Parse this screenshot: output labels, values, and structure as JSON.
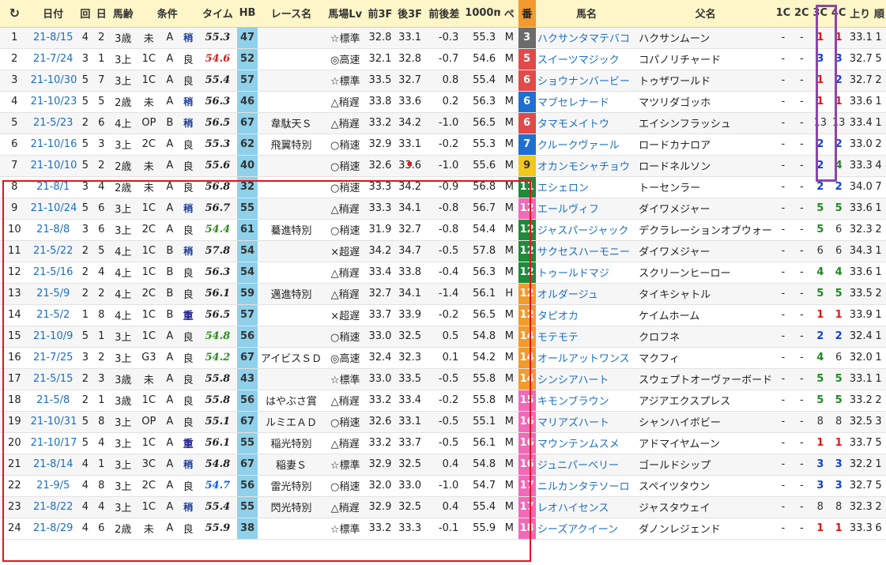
{
  "header": {
    "reload_glyph": "↻",
    "cols": [
      "日付",
      "回",
      "日",
      "馬齢",
      "条件",
      "",
      "",
      "タイム",
      "HB",
      "レース名",
      "馬場Lv",
      "前3F",
      "後3F",
      "前後差",
      "1000m",
      "ペ",
      "番",
      "馬名",
      "父名",
      "1C",
      "2C",
      "3C",
      "4C",
      "上り",
      "順"
    ]
  },
  "colors": {
    "red_box": "#e8121e",
    "purple_box": "#8e44ad",
    "hb_bg": "#8fd1ea",
    "header_bg": "#fdf6c8"
  },
  "rows": [
    {
      "no": "1",
      "date": "21-8/15",
      "kai": "4",
      "nichi": "2",
      "rei": "3歳",
      "jk": "未",
      "cls": "A",
      "baba": "稍",
      "time": "55.3",
      "tc": "black",
      "hb": "47",
      "race": "",
      "lv": "☆標準",
      "f3": "32.8",
      "l3": "33.1",
      "diff": "-0.3",
      "m1000": "55.3",
      "pe": "M",
      "ban": "3",
      "banc": "#6b6b6b",
      "horse": "ハクサンタマテバコ",
      "father": "ハクサンムーン",
      "c1": "-",
      "c2": "-",
      "c3": "1",
      "c3c": "red",
      "c4": "1",
      "c4c": "red",
      "agari": "33.1",
      "juni": "1",
      "bar": "#f7d2c4"
    },
    {
      "no": "2",
      "date": "21-7/24",
      "kai": "3",
      "nichi": "1",
      "rei": "3上",
      "jk": "1C",
      "cls": "A",
      "baba": "良",
      "time": "54.6",
      "tc": "red",
      "hb": "52",
      "race": "",
      "lv": "◎高速",
      "f3": "32.1",
      "l3": "32.8",
      "diff": "-0.7",
      "m1000": "54.6",
      "pe": "M",
      "ban": "5",
      "banc": "#e24a4a",
      "horse": "スイーツマジック",
      "father": "コパノリチャード",
      "c1": "-",
      "c2": "-",
      "c3": "3",
      "c3c": "blue",
      "c4": "3",
      "c4c": "blue",
      "agari": "32.7",
      "juni": "5",
      "bar": ""
    },
    {
      "no": "3",
      "date": "21-10/30",
      "kai": "5",
      "nichi": "7",
      "rei": "3上",
      "jk": "1C",
      "cls": "A",
      "baba": "良",
      "time": "55.4",
      "tc": "black",
      "hb": "57",
      "race": "",
      "lv": "☆標準",
      "f3": "33.5",
      "l3": "32.7",
      "diff": "0.8",
      "m1000": "55.4",
      "pe": "M",
      "ban": "6",
      "banc": "#e24a4a",
      "horse": "ショウナンバービー",
      "father": "トゥザワールド",
      "c1": "-",
      "c2": "-",
      "c3": "1",
      "c3c": "red",
      "c4": "2",
      "c4c": "blue",
      "agari": "32.7",
      "juni": "2",
      "bar": "#fde2a8"
    },
    {
      "no": "4",
      "date": "21-10/23",
      "kai": "5",
      "nichi": "5",
      "rei": "2歳",
      "jk": "未",
      "cls": "A",
      "baba": "稍",
      "time": "56.3",
      "tc": "black",
      "hb": "46",
      "race": "",
      "lv": "△稍遅",
      "f3": "33.8",
      "l3": "33.6",
      "diff": "0.2",
      "m1000": "56.3",
      "pe": "M",
      "ban": "6",
      "banc": "#1f6fd1",
      "horse": "マブセレナード",
      "father": "マツリダゴッホ",
      "c1": "-",
      "c2": "-",
      "c3": "1",
      "c3c": "red",
      "c4": "1",
      "c4c": "red",
      "agari": "33.6",
      "juni": "1",
      "bar": "#f7d2c4"
    },
    {
      "no": "5",
      "date": "21-5/23",
      "kai": "2",
      "nichi": "6",
      "rei": "4上",
      "jk": "OP",
      "cls": "B",
      "baba": "稍",
      "time": "56.5",
      "tc": "black",
      "hb": "67",
      "race": "韋駄天Ｓ",
      "lv": "△稍遅",
      "f3": "33.2",
      "l3": "34.2",
      "diff": "-1.0",
      "m1000": "56.5",
      "pe": "M",
      "ban": "6",
      "banc": "#e24a4a",
      "horse": "タマモメイトウ",
      "father": "エイシンフラッシュ",
      "c1": "-",
      "c2": "-",
      "c3": "13",
      "c3c": "black",
      "c4": "13",
      "c4c": "black",
      "agari": "33.4",
      "juni": "1",
      "bar": "#c9d6f5"
    },
    {
      "no": "6",
      "date": "21-10/16",
      "kai": "5",
      "nichi": "3",
      "rei": "3上",
      "jk": "2C",
      "cls": "A",
      "baba": "良",
      "time": "55.3",
      "tc": "black",
      "hb": "62",
      "race": "飛翼特別",
      "lv": "○稍速",
      "f3": "32.9",
      "l3": "33.1",
      "diff": "-0.2",
      "m1000": "55.3",
      "pe": "M",
      "ban": "7",
      "banc": "#1f6fd1",
      "horse": "クルークヴァール",
      "father": "ロードカナロア",
      "c1": "-",
      "c2": "-",
      "c3": "2",
      "c3c": "blue",
      "c4": "2",
      "c4c": "blue",
      "agari": "33.0",
      "juni": "2",
      "bar": "#fde2a8"
    },
    {
      "no": "7",
      "date": "21-10/10",
      "kai": "5",
      "nichi": "2",
      "rei": "2歳",
      "jk": "未",
      "cls": "A",
      "baba": "良",
      "time": "55.6",
      "tc": "black",
      "hb": "40",
      "race": "",
      "lv": "○稍速",
      "f3": "32.6",
      "l3": "33.6",
      "diff": "-1.0",
      "m1000": "55.6",
      "pe": "M",
      "ban": "9",
      "banc": "#f2c91a",
      "horse": "オカンモシャチョウ",
      "father": "ロードネルソン",
      "c1": "-",
      "c2": "-",
      "c3": "2",
      "c3c": "blue",
      "c4": "4",
      "c4c": "green",
      "agari": "33.3",
      "juni": "4",
      "bar": ""
    },
    {
      "no": "8",
      "date": "21-8/1",
      "kai": "3",
      "nichi": "4",
      "rei": "2歳",
      "jk": "未",
      "cls": "A",
      "baba": "良",
      "time": "56.8",
      "tc": "black",
      "hb": "32",
      "race": "",
      "lv": "○稍速",
      "f3": "33.3",
      "l3": "34.2",
      "diff": "-0.9",
      "m1000": "56.8",
      "pe": "M",
      "ban": "11",
      "banc": "#1f8a3a",
      "horse": "エシェロン",
      "father": "トーセンラー",
      "c1": "-",
      "c2": "-",
      "c3": "2",
      "c3c": "blue",
      "c4": "2",
      "c4c": "blue",
      "agari": "34.0",
      "juni": "7",
      "bar": ""
    },
    {
      "no": "9",
      "date": "21-10/24",
      "kai": "5",
      "nichi": "6",
      "rei": "3上",
      "jk": "1C",
      "cls": "A",
      "baba": "稍",
      "time": "56.7",
      "tc": "black",
      "hb": "55",
      "race": "",
      "lv": "△稍遅",
      "f3": "33.3",
      "l3": "34.1",
      "diff": "-0.8",
      "m1000": "56.7",
      "pe": "M",
      "ban": "12",
      "banc": "#f06ab8",
      "horse": "エールヴィフ",
      "father": "ダイワメジャー",
      "c1": "-",
      "c2": "-",
      "c3": "5",
      "c3c": "green",
      "c4": "5",
      "c4c": "green",
      "agari": "33.6",
      "juni": "1",
      "bar": "#f7d2c4"
    },
    {
      "no": "10",
      "date": "21-8/8",
      "kai": "3",
      "nichi": "6",
      "rei": "3上",
      "jk": "2C",
      "cls": "A",
      "baba": "良",
      "time": "54.4",
      "tc": "green",
      "hb": "61",
      "race": "驀進特別",
      "lv": "○稍速",
      "f3": "31.9",
      "l3": "32.7",
      "diff": "-0.8",
      "m1000": "54.4",
      "pe": "M",
      "ban": "12",
      "banc": "#1f8a3a",
      "horse": "ジャスパージャック",
      "father": "デクラレーションオブウォー",
      "c1": "-",
      "c2": "-",
      "c3": "5",
      "c3c": "green",
      "c4": "6",
      "c4c": "black",
      "agari": "32.3",
      "juni": "2",
      "bar": "#fde2a8"
    },
    {
      "no": "11",
      "date": "21-5/22",
      "kai": "2",
      "nichi": "5",
      "rei": "4上",
      "jk": "1C",
      "cls": "B",
      "baba": "稍",
      "time": "57.8",
      "tc": "black",
      "hb": "54",
      "race": "",
      "lv": "×超遅",
      "f3": "34.2",
      "l3": "34.7",
      "diff": "-0.5",
      "m1000": "57.8",
      "pe": "M",
      "ban": "12",
      "banc": "#1f8a3a",
      "horse": "サクセスハーモニー",
      "father": "ダイワメジャー",
      "c1": "-",
      "c2": "-",
      "c3": "6",
      "c3c": "black",
      "c4": "6",
      "c4c": "black",
      "agari": "34.3",
      "juni": "1",
      "bar": "#f7d2c4"
    },
    {
      "no": "12",
      "date": "21-5/16",
      "kai": "2",
      "nichi": "4",
      "rei": "4上",
      "jk": "1C",
      "cls": "B",
      "baba": "良",
      "time": "56.3",
      "tc": "black",
      "hb": "54",
      "race": "",
      "lv": "△稍遅",
      "f3": "33.4",
      "l3": "33.8",
      "diff": "-0.4",
      "m1000": "56.3",
      "pe": "M",
      "ban": "12",
      "banc": "#1f8a3a",
      "horse": "トゥールドマジ",
      "father": "スクリーンヒーロー",
      "c1": "-",
      "c2": "-",
      "c3": "4",
      "c3c": "green",
      "c4": "4",
      "c4c": "green",
      "agari": "33.6",
      "juni": "1",
      "bar": "#f7d2c4"
    },
    {
      "no": "13",
      "date": "21-5/9",
      "kai": "2",
      "nichi": "2",
      "rei": "4上",
      "jk": "2C",
      "cls": "B",
      "baba": "良",
      "time": "56.1",
      "tc": "black",
      "hb": "59",
      "race": "邁進特別",
      "lv": "△稍遅",
      "f3": "32.7",
      "l3": "34.1",
      "diff": "-1.4",
      "m1000": "56.1",
      "pe": "H",
      "ban": "12",
      "banc": "#f39a2e",
      "horse": "オルダージュ",
      "father": "タイキシャトル",
      "c1": "-",
      "c2": "-",
      "c3": "5",
      "c3c": "green",
      "c4": "5",
      "c4c": "green",
      "agari": "33.5",
      "juni": "2",
      "bar": "#c9d6f5"
    },
    {
      "no": "14",
      "date": "21-5/2",
      "kai": "1",
      "nichi": "8",
      "rei": "4上",
      "jk": "1C",
      "cls": "B",
      "baba": "重",
      "time": "56.5",
      "tc": "black",
      "hb": "57",
      "race": "",
      "lv": "×超遅",
      "f3": "33.7",
      "l3": "33.9",
      "diff": "-0.2",
      "m1000": "56.5",
      "pe": "M",
      "ban": "12",
      "banc": "#f39a2e",
      "horse": "タピオカ",
      "father": "ケイムホーム",
      "c1": "-",
      "c2": "-",
      "c3": "1",
      "c3c": "red",
      "c4": "1",
      "c4c": "red",
      "agari": "33.9",
      "juni": "1",
      "bar": "#f7d2c4"
    },
    {
      "no": "15",
      "date": "21-10/9",
      "kai": "5",
      "nichi": "1",
      "rei": "3上",
      "jk": "1C",
      "cls": "A",
      "baba": "良",
      "time": "54.8",
      "tc": "green",
      "hb": "56",
      "race": "",
      "lv": "○稍速",
      "f3": "33.0",
      "l3": "32.5",
      "diff": "0.5",
      "m1000": "54.8",
      "pe": "M",
      "ban": "14",
      "banc": "#f39a2e",
      "horse": "モテモテ",
      "father": "クロフネ",
      "c1": "-",
      "c2": "-",
      "c3": "2",
      "c3c": "blue",
      "c4": "2",
      "c4c": "blue",
      "agari": "32.4",
      "juni": "1",
      "bar": "#f7d2c4"
    },
    {
      "no": "16",
      "date": "21-7/25",
      "kai": "3",
      "nichi": "2",
      "rei": "3上",
      "jk": "G3",
      "cls": "A",
      "baba": "良",
      "time": "54.2",
      "tc": "green",
      "hb": "67",
      "race": "アイビスＳＤ",
      "lv": "◎高速",
      "f3": "32.4",
      "l3": "32.3",
      "diff": "0.1",
      "m1000": "54.2",
      "pe": "M",
      "ban": "14",
      "banc": "#f39a2e",
      "horse": "オールアットワンス",
      "father": "マクフィ",
      "c1": "-",
      "c2": "-",
      "c3": "4",
      "c3c": "green",
      "c4": "6",
      "c4c": "black",
      "agari": "32.0",
      "juni": "1",
      "bar": "#f7d2c4"
    },
    {
      "no": "17",
      "date": "21-5/15",
      "kai": "2",
      "nichi": "3",
      "rei": "3歳",
      "jk": "未",
      "cls": "A",
      "baba": "良",
      "time": "55.8",
      "tc": "black",
      "hb": "43",
      "race": "",
      "lv": "☆標準",
      "f3": "33.0",
      "l3": "33.5",
      "diff": "-0.5",
      "m1000": "55.8",
      "pe": "M",
      "ban": "14",
      "banc": "#f39a2e",
      "horse": "シンシアハート",
      "father": "スウェプトオーヴァーボード",
      "c1": "-",
      "c2": "-",
      "c3": "5",
      "c3c": "green",
      "c4": "5",
      "c4c": "green",
      "agari": "33.1",
      "juni": "1",
      "bar": "#f7d2c4"
    },
    {
      "no": "18",
      "date": "21-5/8",
      "kai": "2",
      "nichi": "1",
      "rei": "3歳",
      "jk": "1C",
      "cls": "A",
      "baba": "良",
      "time": "55.8",
      "tc": "black",
      "hb": "56",
      "race": "はやぶさ賞",
      "lv": "△稍遅",
      "f3": "33.2",
      "l3": "33.4",
      "diff": "-0.2",
      "m1000": "55.8",
      "pe": "M",
      "ban": "15",
      "banc": "#f06ab8",
      "horse": "キモンブラウン",
      "father": "アジアエクスプレス",
      "c1": "-",
      "c2": "-",
      "c3": "5",
      "c3c": "green",
      "c4": "5",
      "c4c": "green",
      "agari": "33.2",
      "juni": "2",
      "bar": "#fde2a8"
    },
    {
      "no": "19",
      "date": "21-10/31",
      "kai": "5",
      "nichi": "8",
      "rei": "3上",
      "jk": "OP",
      "cls": "A",
      "baba": "良",
      "time": "55.1",
      "tc": "black",
      "hb": "67",
      "race": "ルミエＡＤ",
      "lv": "○稍速",
      "f3": "32.6",
      "l3": "33.1",
      "diff": "-0.5",
      "m1000": "55.1",
      "pe": "M",
      "ban": "16",
      "banc": "#f06ab8",
      "horse": "マリアズハート",
      "father": "シャンハイボビー",
      "c1": "-",
      "c2": "-",
      "c3": "8",
      "c3c": "black",
      "c4": "8",
      "c4c": "black",
      "agari": "32.5",
      "juni": "3",
      "bar": "#c9d6f5"
    },
    {
      "no": "20",
      "date": "21-10/17",
      "kai": "5",
      "nichi": "4",
      "rei": "3上",
      "jk": "1C",
      "cls": "A",
      "baba": "重",
      "time": "56.1",
      "tc": "black",
      "hb": "55",
      "race": "稲光特別",
      "lv": "△稍遅",
      "f3": "33.2",
      "l3": "33.7",
      "diff": "-0.5",
      "m1000": "56.1",
      "pe": "M",
      "ban": "16",
      "banc": "#f06ab8",
      "horse": "マウンテンムスメ",
      "father": "アドマイヤムーン",
      "c1": "-",
      "c2": "-",
      "c3": "1",
      "c3c": "red",
      "c4": "1",
      "c4c": "red",
      "agari": "33.7",
      "juni": "5",
      "bar": "#f3a76a"
    },
    {
      "no": "21",
      "date": "21-8/14",
      "kai": "4",
      "nichi": "1",
      "rei": "3上",
      "jk": "3C",
      "cls": "A",
      "baba": "稍",
      "time": "54.8",
      "tc": "black",
      "hb": "67",
      "race": "稲妻Ｓ",
      "lv": "☆標準",
      "f3": "32.9",
      "l3": "32.5",
      "diff": "0.4",
      "m1000": "54.8",
      "pe": "M",
      "ban": "16",
      "banc": "#f06ab8",
      "horse": "ジュニパーベリー",
      "father": "ゴールドシップ",
      "c1": "-",
      "c2": "-",
      "c3": "3",
      "c3c": "blue",
      "c4": "3",
      "c4c": "blue",
      "agari": "32.2",
      "juni": "1",
      "bar": "#f7d2c4"
    },
    {
      "no": "22",
      "date": "21-9/5",
      "kai": "4",
      "nichi": "8",
      "rei": "3上",
      "jk": "2C",
      "cls": "A",
      "baba": "良",
      "time": "54.7",
      "tc": "blue",
      "hb": "56",
      "race": "雷光特別",
      "lv": "○稍速",
      "f3": "32.0",
      "l3": "33.0",
      "diff": "-1.0",
      "m1000": "54.7",
      "pe": "M",
      "ban": "17",
      "banc": "#f06ab8",
      "horse": "ニルカンタテソーロ",
      "father": "スペイツタウン",
      "c1": "-",
      "c2": "-",
      "c3": "3",
      "c3c": "blue",
      "c4": "3",
      "c4c": "blue",
      "agari": "32.7",
      "juni": "5",
      "bar": "#f3a76a"
    },
    {
      "no": "23",
      "date": "21-8/22",
      "kai": "4",
      "nichi": "4",
      "rei": "3上",
      "jk": "1C",
      "cls": "A",
      "baba": "稍",
      "time": "55.4",
      "tc": "black",
      "hb": "55",
      "race": "閃光特別",
      "lv": "△稍遅",
      "f3": "32.9",
      "l3": "32.5",
      "diff": "0.4",
      "m1000": "55.4",
      "pe": "M",
      "ban": "17",
      "banc": "#f06ab8",
      "horse": "レオハイセンス",
      "father": "ジャスタウェイ",
      "c1": "-",
      "c2": "-",
      "c3": "8",
      "c3c": "black",
      "c4": "8",
      "c4c": "black",
      "agari": "32.3",
      "juni": "2",
      "bar": "#fde2a8"
    },
    {
      "no": "24",
      "date": "21-8/29",
      "kai": "4",
      "nichi": "6",
      "rei": "2歳",
      "jk": "未",
      "cls": "A",
      "baba": "良",
      "time": "55.9",
      "tc": "black",
      "hb": "38",
      "race": "",
      "lv": "☆標準",
      "f3": "33.2",
      "l3": "33.3",
      "diff": "-0.1",
      "m1000": "55.9",
      "pe": "M",
      "ban": "18",
      "banc": "#f06ab8",
      "horse": "シーズアクイーン",
      "father": "ダノンレジェンド",
      "c1": "-",
      "c2": "-",
      "c3": "1",
      "c3c": "red",
      "c4": "1",
      "c4c": "red",
      "agari": "33.3",
      "juni": "6",
      "bar": ""
    }
  ]
}
